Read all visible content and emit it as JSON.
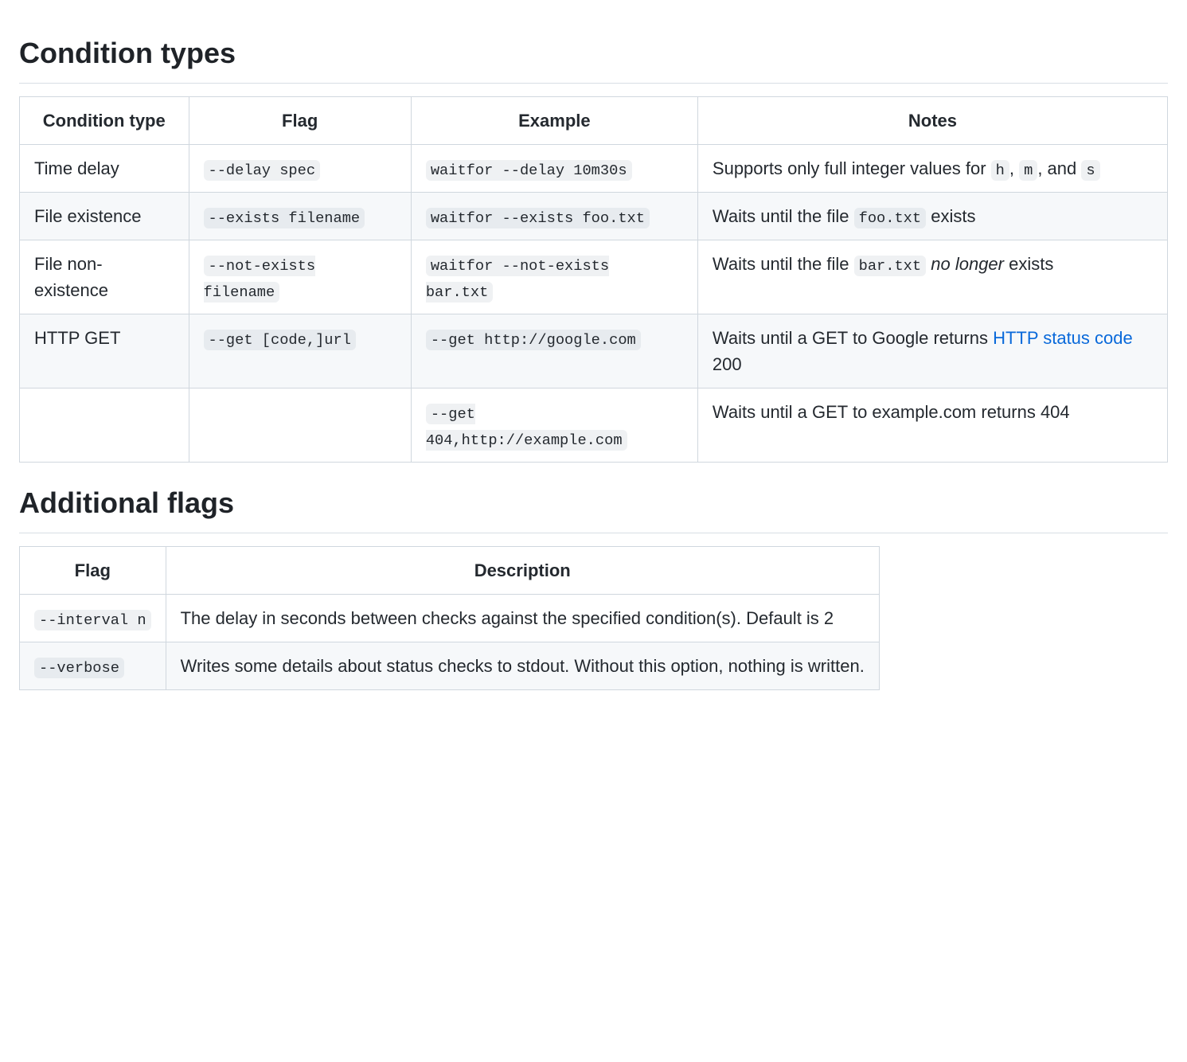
{
  "sections": {
    "condition_types": {
      "heading": "Condition types",
      "headers": {
        "type": "Condition type",
        "flag": "Flag",
        "example": "Example",
        "notes": "Notes"
      },
      "rows": [
        {
          "type": "Time delay",
          "flag_code": "--delay spec",
          "example_code": "waitfor --delay 10m30s",
          "notes": {
            "pre": "Supports only full integer values for ",
            "c1": "h",
            "mid1": ", ",
            "c2": "m",
            "mid2": ", and ",
            "c3": "s",
            "post": ""
          }
        },
        {
          "type": "File existence",
          "flag_code": "--exists filename",
          "example_code": "waitfor --exists foo.txt",
          "notes": {
            "pre": "Waits until the file ",
            "c1": "foo.txt",
            "post": " exists"
          }
        },
        {
          "type": "File non-existence",
          "flag_code": "--not-exists filename",
          "example_code": "waitfor --not-exists bar.txt",
          "notes": {
            "pre": "Waits until the file ",
            "c1": "bar.txt",
            "em": "no longer",
            "post": " exists"
          }
        },
        {
          "type": "HTTP GET",
          "flag_code": "--get [code,]url",
          "example_code": "--get http://google.com",
          "notes": {
            "pre": "Waits until a GET to Google returns ",
            "link": "HTTP status code",
            "post": " 200"
          }
        },
        {
          "type": "",
          "flag_code": "",
          "example_code": "--get 404,http://example.com",
          "notes": {
            "pre": "Waits until a GET to example.com returns 404"
          }
        }
      ]
    },
    "additional_flags": {
      "heading": "Additional flags",
      "headers": {
        "flag": "Flag",
        "description": "Description"
      },
      "rows": [
        {
          "flag_code": "--interval n",
          "description": "The delay in seconds between checks against the specified condition(s). Default is 2"
        },
        {
          "flag_code": "--verbose",
          "description": "Writes some details about status checks to stdout. Without this option, nothing is written."
        }
      ]
    }
  }
}
